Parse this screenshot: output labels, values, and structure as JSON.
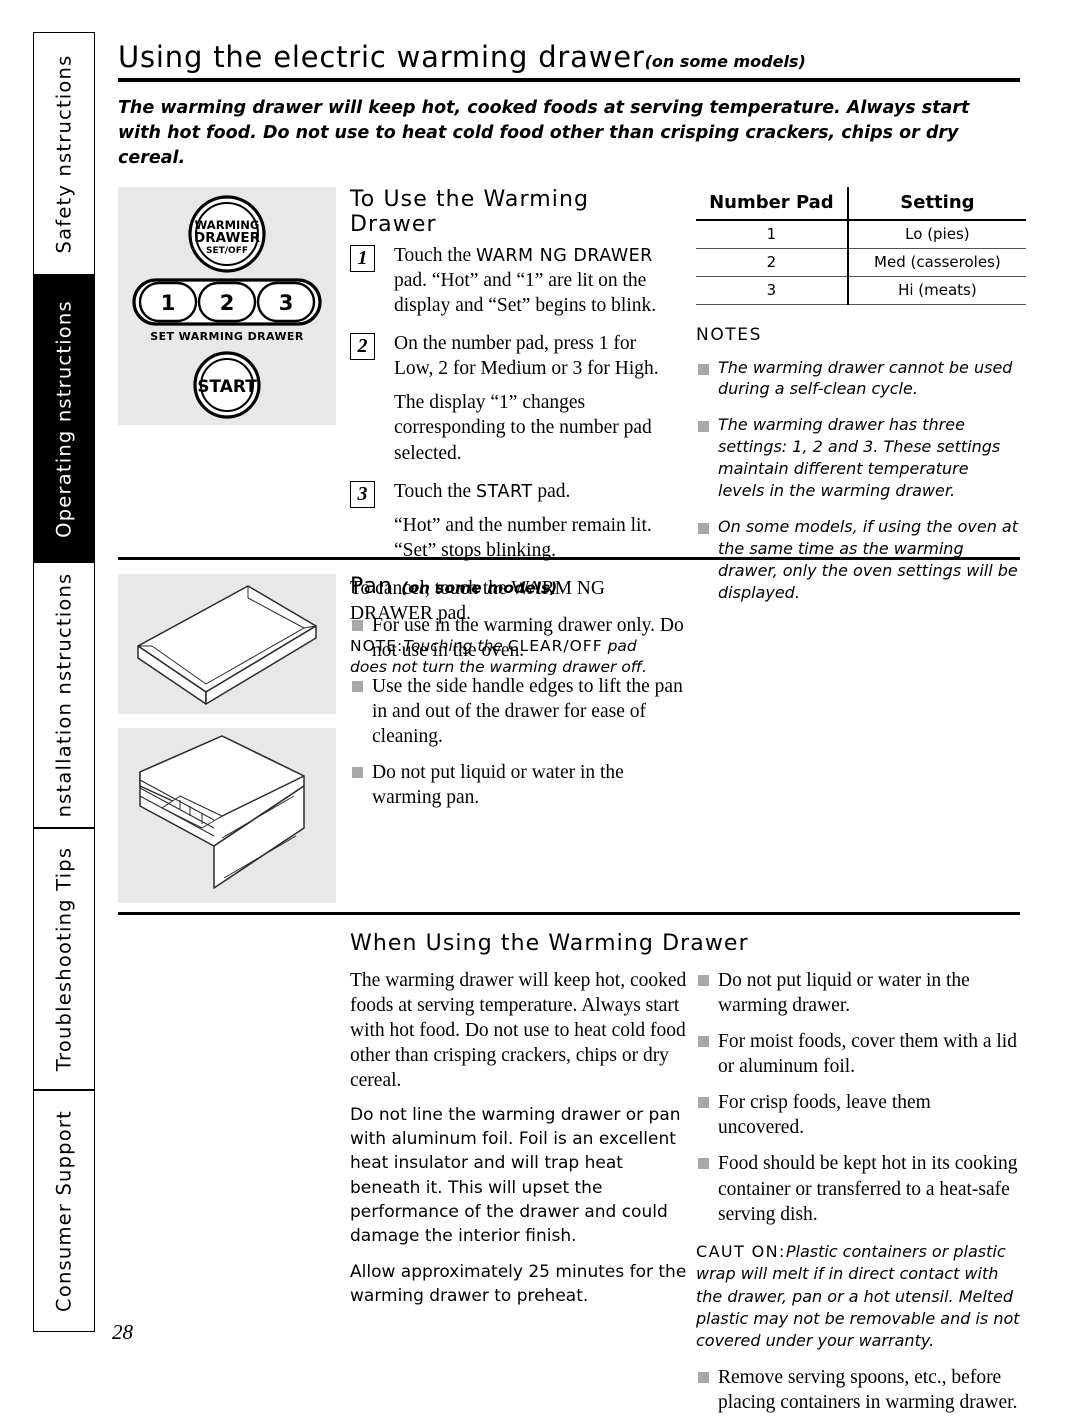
{
  "sidebar": {
    "tabs": [
      {
        "label": "Safety nstructions",
        "active": false
      },
      {
        "label": "Operating nstructions",
        "active": true
      },
      {
        "label": "nstallation nstructions",
        "active": false
      },
      {
        "label": "Troubleshooting Tips",
        "active": false
      },
      {
        "label": "Consumer Support",
        "active": false
      }
    ]
  },
  "page_number": "28",
  "header": {
    "title": "Using the electric warming drawer",
    "title_models": "(on some models)",
    "intro": "The warming drawer will keep hot, cooked foods at serving temperature. Always start with hot food. Do not use to heat cold food other than crisping crackers, chips or dry cereal."
  },
  "use_section": {
    "heading": "To Use the Warming Drawer",
    "steps": [
      {
        "num": "1",
        "pre": "Touch the ",
        "ui": "WARM NG DRAWER",
        "post": " pad. “Hot” and “1” are lit on the display and “Set” begins to blink.",
        "extra": ""
      },
      {
        "num": "2",
        "pre": "On the number pad, press 1 for Low, 2 for Medium or 3 for High.",
        "ui": "",
        "post": "",
        "extra": "The display “1” changes corresponding to the number pad selected."
      },
      {
        "num": "3",
        "pre": "Touch the ",
        "ui": "START",
        "post": " pad.",
        "extra": "“Hot” and the number remain lit. “Set” stops blinking."
      }
    ],
    "cancel_pre": "To cancel, touch the ",
    "cancel_ui": "WARM NG DRAWER",
    "cancel_post": " pad.",
    "note_lead": "NOTE:",
    "note_a": "Touching the ",
    "note_ui": "CLEAR/OFF",
    "note_b": " pad does not turn the warming drawer off."
  },
  "settings_table": {
    "headers": [
      "Number Pad",
      "Setting"
    ],
    "rows": [
      [
        "1",
        "Lo (pies)"
      ],
      [
        "2",
        "Med (casseroles)"
      ],
      [
        "3",
        "Hi (meats)"
      ]
    ]
  },
  "notes": {
    "title": "NOTES",
    "items": [
      "The warming drawer cannot be used during a self-clean cycle.",
      "The warming drawer has three settings: 1, 2 and 3. These settings maintain different temperature levels in the warming drawer.",
      "On some models, if using the oven at the same time as the warming drawer, only the oven settings will be displayed."
    ]
  },
  "pan_section": {
    "heading": "Pan",
    "heading_sub": "(on some models)",
    "items": [
      "For use in the warming drawer only. Do not use in the oven.",
      "Use the side handle edges to lift the pan in and out of the drawer for ease of cleaning.",
      "Do not put liquid or water in the warming pan."
    ]
  },
  "when_using": {
    "heading": "When Using the Warming Drawer",
    "left_paragraph_serif": "The warming drawer will keep hot, cooked foods at serving temperature. Always start with hot food. Do not use to heat cold food other than crisping crackers, chips or dry cereal.",
    "left_paragraph_sans_1": "Do not line the warming drawer or pan with aluminum foil. Foil is an excellent heat insulator and will trap heat beneath it. This will upset the performance of the drawer and could damage the interior finish.",
    "left_paragraph_sans_2": "Allow approximately 25 minutes for the warming drawer to preheat.",
    "right_items_top": [
      "Do not put liquid or water in the warming drawer.",
      "For moist foods, cover them with a lid or aluminum foil.",
      "For crisp foods, leave them uncovered.",
      "Food should be kept hot in its cooking container or transferred to a heat-safe serving dish."
    ],
    "caution_lead": "CAUT ON:",
    "caution_text": "Plastic containers or plastic wrap will melt if in direct contact with the drawer, pan or a hot utensil. Melted plastic may not be removable and is not covered under your warranty.",
    "right_items_bottom": [
      "Remove serving spoons, etc., before placing containers in warming drawer."
    ]
  },
  "control_panel": {
    "warming_drawer_line1": "WARMING",
    "warming_drawer_line2": "DRAWER",
    "warming_drawer_line3": "SET/OFF",
    "pads": [
      "1",
      "2",
      "3"
    ],
    "pad_caption": "SET WARMING DRAWER",
    "start_label": "START"
  }
}
